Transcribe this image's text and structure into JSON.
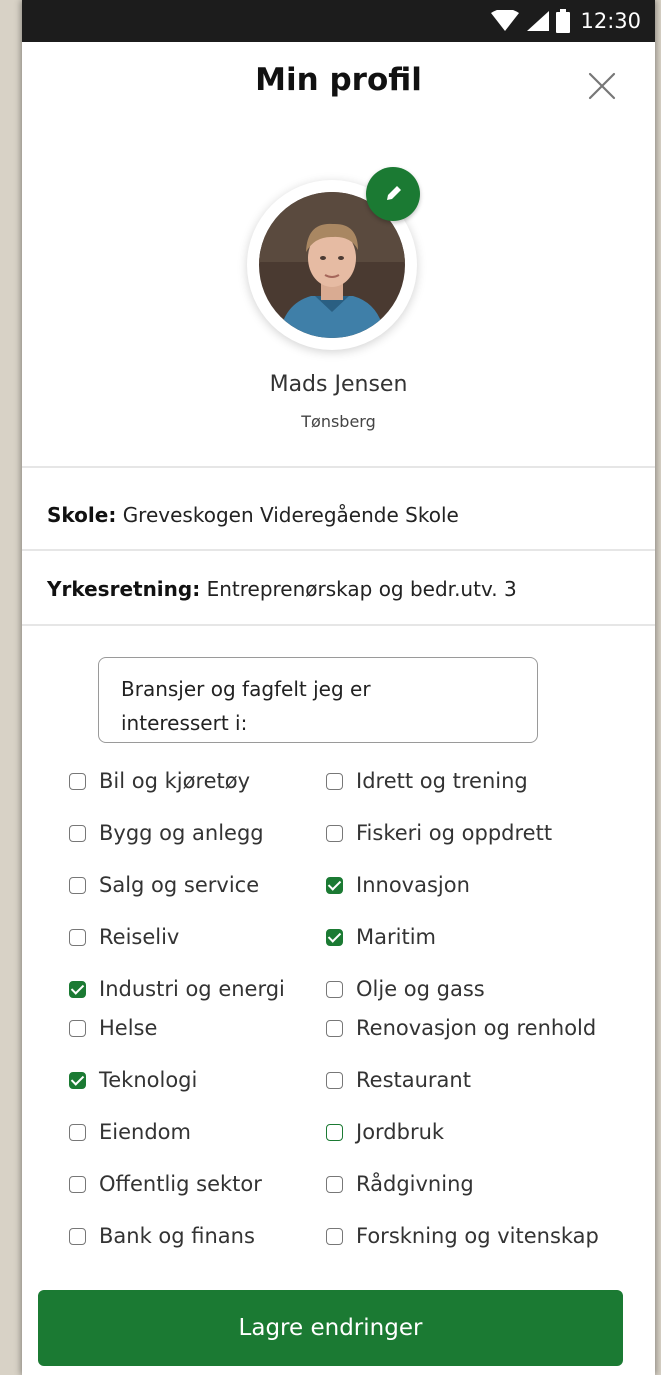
{
  "status_bar": {
    "time": "12:30"
  },
  "header": {
    "title": "Min profil"
  },
  "profile": {
    "name": "Mads Jensen",
    "city": "Tønsberg"
  },
  "school": {
    "label": "Skole:",
    "value": "Greveskogen Videregående Skole"
  },
  "program": {
    "label": "Yrkesretning:",
    "value": "Entreprenørskap og bedr.utv. 3"
  },
  "interests": {
    "heading_line1": "Bransjer og fagfelt  jeg er",
    "heading_line2": "interessert i:",
    "left": [
      {
        "label": "Bil og kjøretøy",
        "checked": false
      },
      {
        "label": "Bygg og anlegg",
        "checked": false
      },
      {
        "label": "Salg og service",
        "checked": false
      },
      {
        "label": "Reiseliv",
        "checked": false
      },
      {
        "label": "Industri og energi",
        "checked": true
      },
      {
        "label": "Helse",
        "checked": false
      },
      {
        "label": "Teknologi",
        "checked": true
      },
      {
        "label": "Eiendom",
        "checked": false
      },
      {
        "label": "Offentlig sektor",
        "checked": false
      },
      {
        "label": "Bank og finans",
        "checked": false
      }
    ],
    "right": [
      {
        "label": "Idrett og trening",
        "checked": false
      },
      {
        "label": "Fiskeri og oppdrett",
        "checked": false
      },
      {
        "label": "Innovasjon",
        "checked": true
      },
      {
        "label": "Maritim",
        "checked": true
      },
      {
        "label": "Olje og gass",
        "checked": false
      },
      {
        "label": "Renovasjon og renhold",
        "checked": false
      },
      {
        "label": "Restaurant",
        "checked": false
      },
      {
        "label": "Jordbruk",
        "checked": false
      },
      {
        "label": "Rådgivning",
        "checked": false
      },
      {
        "label": "Forskning og vitenskap",
        "checked": false
      }
    ]
  },
  "actions": {
    "save_label": "Lagre endringer"
  },
  "colors": {
    "accent": "#1b7a33",
    "status_bar": "#1c1c1c"
  },
  "icons": [
    "wifi-icon",
    "signal-icon",
    "battery-icon",
    "close-icon",
    "pencil-icon"
  ]
}
